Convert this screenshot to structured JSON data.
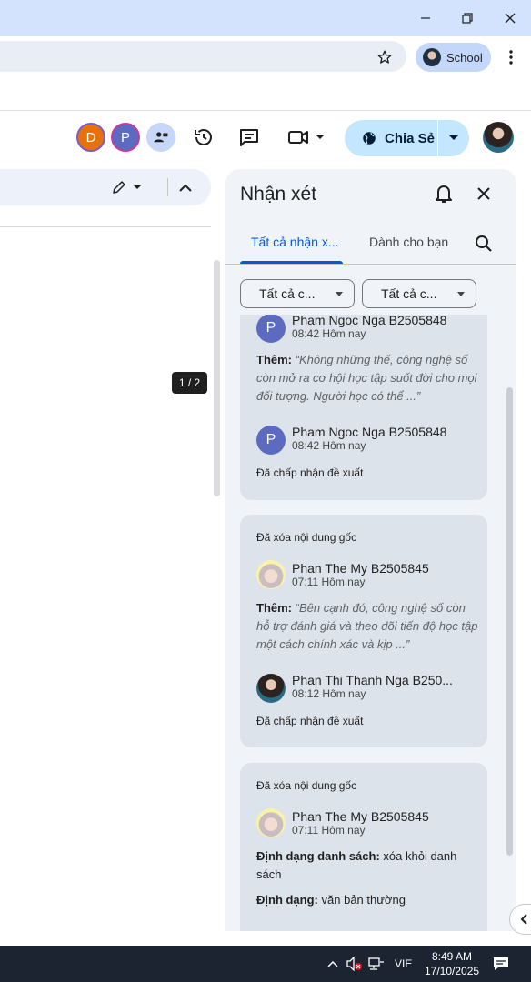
{
  "browser": {
    "profile_label": "School"
  },
  "header": {
    "collaborators": [
      {
        "initial": "D",
        "color": "#e8710a"
      },
      {
        "initial": "P",
        "color": "#5c6bc0"
      }
    ],
    "share_label": "Chia Sẻ"
  },
  "document": {
    "page_indicator": "1 / 2"
  },
  "comments": {
    "title": "Nhận xét",
    "tabs": [
      {
        "label": "Tất cả nhận x...",
        "selected": true
      },
      {
        "label": "Dành cho bạn",
        "selected": false
      }
    ],
    "filters": [
      {
        "label": "Tất cả c..."
      },
      {
        "label": "Tất cả c..."
      }
    ],
    "cards": [
      {
        "author1": "Pham Ngoc Nga B2505848",
        "time1": "08:42 Hôm nay",
        "initial1": "P",
        "body_label": "Thêm:",
        "body_text": "“Không những thế, công nghệ số còn mở ra cơ hội học tập suốt đời cho mọi đối tượng. Người học có thể ...”",
        "author2": "Pham Ngoc Nga B2505848",
        "time2": "08:42 Hôm nay",
        "initial2": "P",
        "status": "Đã chấp nhận đề xuất"
      },
      {
        "note": "Đã xóa nội dung gốc",
        "author1": "Phan The My B2505845",
        "time1": "07:11 Hôm nay",
        "body_label": "Thêm:",
        "body_text": "“Bên cạnh đó, công nghệ số còn hỗ trợ đánh giá và theo dõi tiến độ học tập một cách chính xác và kịp ...”",
        "author2": "Phan Thi Thanh Nga B250...",
        "time2": "08:12 Hôm nay",
        "status": "Đã chấp nhận đề xuất"
      },
      {
        "note": "Đã xóa nội dung gốc",
        "author1": "Phan The My B2505845",
        "time1": "07:11 Hôm nay",
        "line1_label": "Định dạng danh sách:",
        "line1_text": "xóa khỏi danh sách",
        "line2_label": "Định dạng:",
        "line2_text": "văn bản thường"
      }
    ]
  },
  "taskbar": {
    "language": "VIE",
    "time": "8:49 AM",
    "date": "17/10/2025"
  },
  "colors": {
    "accent": "#0b57d0",
    "share_bg": "#c2e7ff",
    "panel_bg": "#f0f4f9",
    "card_bg": "#dde3ea",
    "titlebar_bg": "#d3e3fd"
  }
}
